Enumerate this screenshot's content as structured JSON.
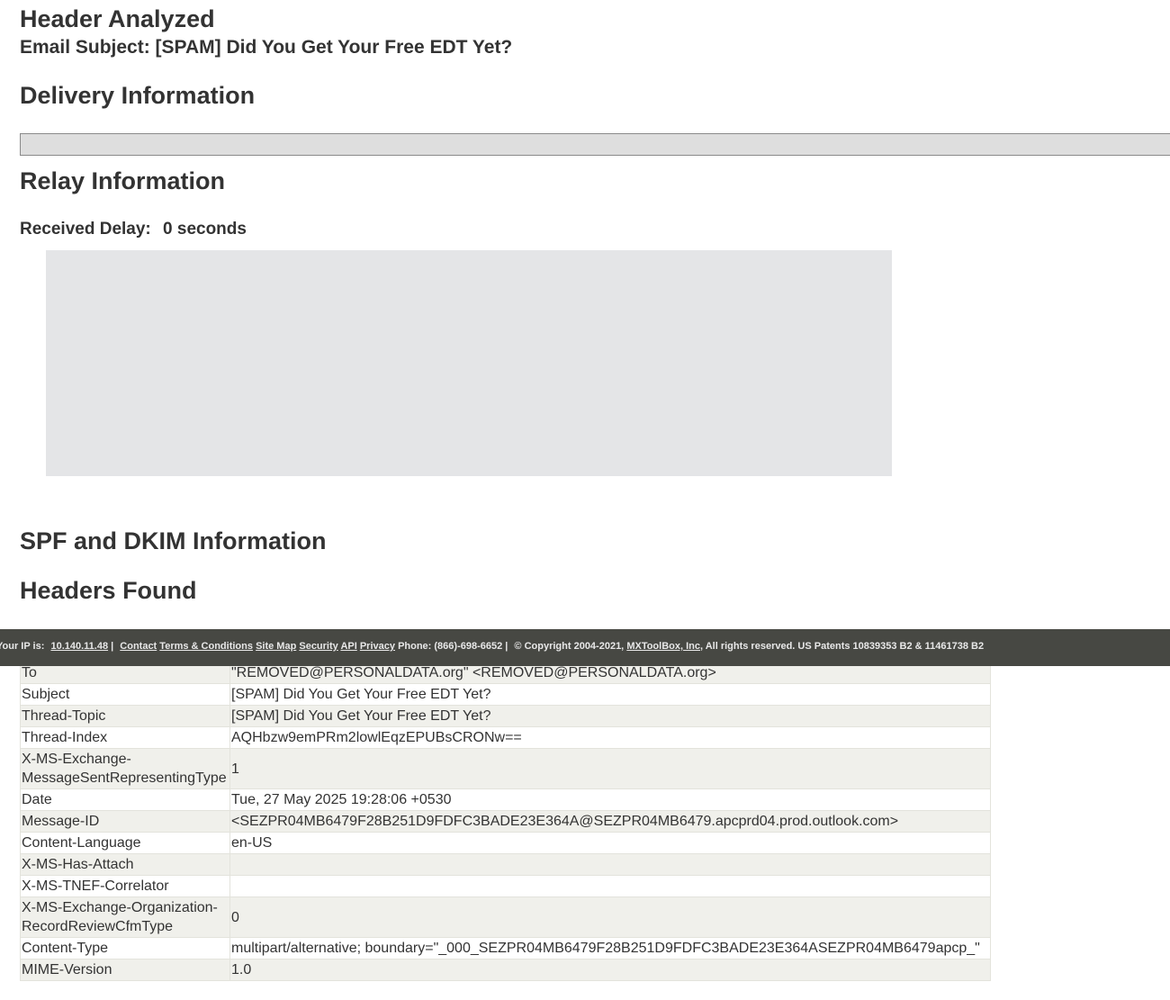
{
  "header": {
    "title": "Header Analyzed",
    "subject_line": "Email Subject: [SPAM] Did You Get Your Free EDT Yet?"
  },
  "sections": {
    "delivery": "Delivery Information",
    "relay": "Relay Information",
    "spf_dkim": "SPF and DKIM Information",
    "headers_found": "Headers Found"
  },
  "relay": {
    "delay_label": "Received Delay:",
    "delay_value": "0 seconds"
  },
  "footer": {
    "ip_label": "Your IP is:",
    "ip_value": "10.140.11.48",
    "sep1": "|",
    "contact": "Contact",
    "terms": "Terms & Conditions",
    "sitemap": "Site Map",
    "security": "Security",
    "api": "API",
    "privacy": "Privacy",
    "phone": "Phone: (866)-698-6652 |",
    "copyright_prefix": "© Copyright 2004-2021,",
    "company": "MXToolBox, Inc",
    "copyright_suffix": ", All rights reserved. US Patents 10839353 B2 & 11461738 B2"
  },
  "headers_table": [
    {
      "key": "To",
      "value": "\"REMOVED@PERSONALDATA.org\" <REMOVED@PERSONALDATA.org>"
    },
    {
      "key": "Subject",
      "value": "[SPAM] Did You Get Your Free EDT Yet?"
    },
    {
      "key": "Thread-Topic",
      "value": "[SPAM] Did You Get Your Free EDT Yet?"
    },
    {
      "key": "Thread-Index",
      "value": "AQHbzw9emPRm2lowlEqzEPUBsCRONw=="
    },
    {
      "key": "X-MS-Exchange-MessageSentRepresentingType",
      "value": "1"
    },
    {
      "key": "Date",
      "value": "Tue, 27 May 2025 19:28:06 +0530"
    },
    {
      "key": "Message-ID",
      "value": "<SEZPR04MB6479F28B251D9FDFC3BADE23E364A@SEZPR04MB6479.apcprd04.prod.outlook.com>"
    },
    {
      "key": "Content-Language",
      "value": "en-US"
    },
    {
      "key": "X-MS-Has-Attach",
      "value": ""
    },
    {
      "key": "X-MS-TNEF-Correlator",
      "value": ""
    },
    {
      "key": "X-MS-Exchange-Organization-RecordReviewCfmType",
      "value": "0"
    },
    {
      "key": "Content-Type",
      "value": "multipart/alternative; boundary=\"_000_SEZPR04MB6479F28B251D9FDFC3BADE23E364ASEZPR04MB6479apcp_\""
    },
    {
      "key": "MIME-Version",
      "value": "1.0"
    }
  ]
}
